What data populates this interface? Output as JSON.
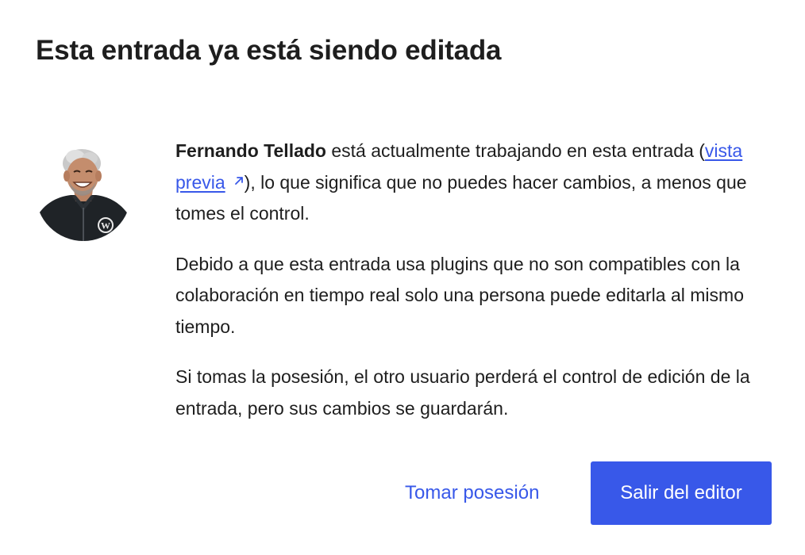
{
  "dialog": {
    "title": "Esta entrada ya está siendo editada",
    "avatar_icon": "user-avatar-photo",
    "paragraph1": {
      "user_name": "Fernando Tellado",
      "text_before_link": " está actualmente trabajando en esta entrada (",
      "link_label": "vista previa",
      "link_icon": "external-link-icon",
      "text_after_link": "), lo que significa que no puedes hacer cambios, a menos que tomes el control."
    },
    "paragraph2": "Debido a que esta entrada usa plugins que no son compatibles con la colaboración en tiempo real solo una persona puede editarla al mismo tiempo.",
    "paragraph3": "Si tomas la posesión, el otro usuario perderá el control de edición de la entrada, pero sus cambios se guardarán.",
    "take_over_label": "Tomar posesión",
    "exit_label": "Salir del editor"
  },
  "colors": {
    "accent": "#3858e9",
    "text": "#1e1e1e",
    "background": "#ffffff"
  }
}
